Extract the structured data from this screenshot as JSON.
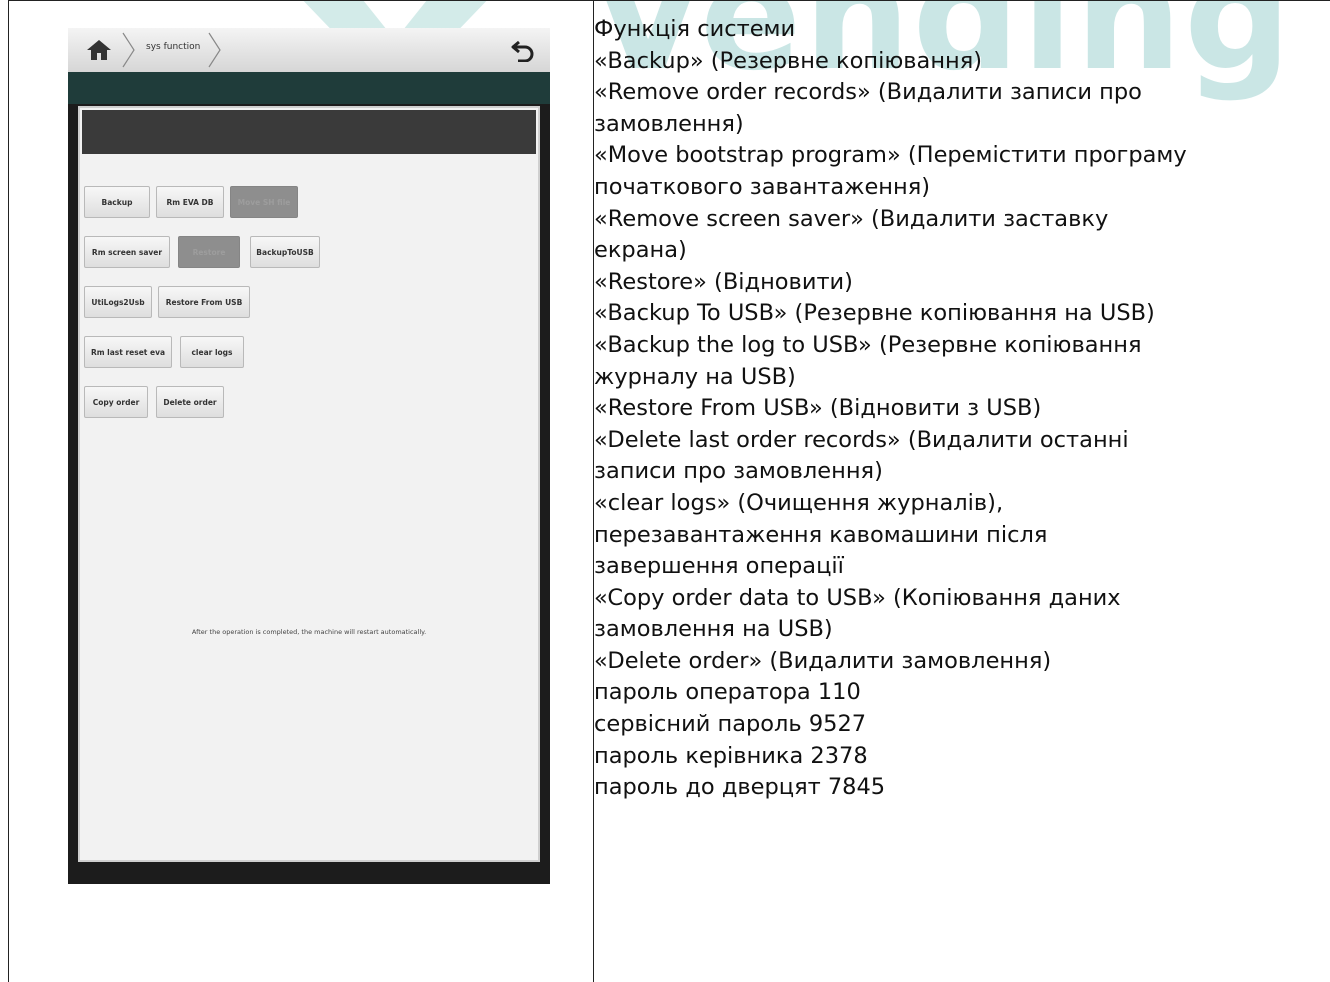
{
  "watermark": {
    "text": "Vending",
    "color": "#9fd3d0"
  },
  "tablet": {
    "breadcrumb": {
      "home_icon": "home-icon",
      "label": "sys function"
    },
    "back_icon": "undo-arrow-icon",
    "buttons": [
      {
        "label": "Backup",
        "enabled": true
      },
      {
        "label": "Rm EVA DB",
        "enabled": true
      },
      {
        "label": "Move SH file",
        "enabled": false
      },
      {
        "label": "Rm screen saver",
        "enabled": true
      },
      {
        "label": "Restore",
        "enabled": false
      },
      {
        "label": "BackupToUSB",
        "enabled": true
      },
      {
        "label": "UtiLogs2Usb",
        "enabled": true
      },
      {
        "label": "Restore From USB",
        "enabled": true
      },
      {
        "label": "Rm last reset eva",
        "enabled": true
      },
      {
        "label": "clear logs",
        "enabled": true
      },
      {
        "label": "Copy order",
        "enabled": true
      },
      {
        "label": "Delete order",
        "enabled": true
      }
    ],
    "note": "After the operation is completed, the machine will restart automatically."
  },
  "text_lines": [
    "Функція системи",
    "«Backup» (Резервне копіювання)",
    "«Remove order records» (Видалити записи про",
    "замовлення)",
    "«Move bootstrap program» (Перемістити програму",
    "початкового завантаження)",
    "«Remove screen saver» (Видалити заставку",
    "екрана)",
    "«Restore» (Відновити)",
    "«Backup To USB» (Резервне копіювання на USB)",
    "«Backup the log to USB» (Резервне копіювання",
    "журналу на USB)",
    "«Restore From USB» (Відновити з USB)",
    "«Delete last order records» (Видалити останні",
    "записи про замовлення)",
    "«clear logs» (Очищення журналів),",
    "перезавантаження кавомашини після",
    "завершення операції",
    "«Copy order data to USB» (Копіювання даних",
    "замовлення на USB)",
    "«Delete order» (Видалити замовлення)",
    "пароль оператора 110",
    "сервісний пароль 9527",
    "пароль керівника 2378",
    "пароль до дверцят 7845"
  ]
}
